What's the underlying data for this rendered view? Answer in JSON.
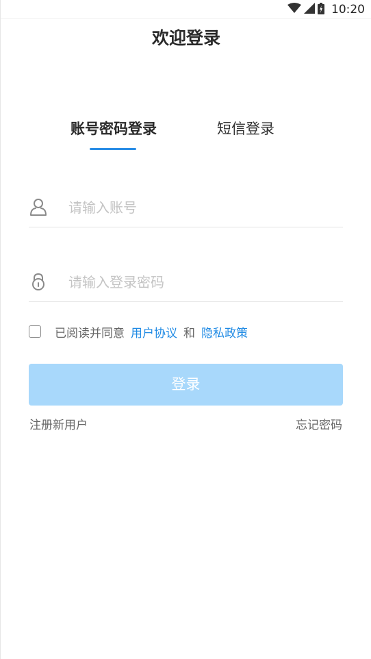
{
  "status_bar": {
    "time": "10:20",
    "icons": [
      "wifi-icon",
      "cell-signal-icon",
      "battery-icon"
    ]
  },
  "header": {
    "title": "欢迎登录"
  },
  "tabs": [
    {
      "label": "账号密码登录",
      "active": true
    },
    {
      "label": "短信登录",
      "active": false
    }
  ],
  "form": {
    "account_placeholder": "请输入账号",
    "account_value": "",
    "password_placeholder": "请输入登录密码",
    "password_value": "",
    "agreement": {
      "checked": false,
      "prefix": "已阅读并同意",
      "user_agreement": "用户协议",
      "and": "和",
      "privacy_policy": "隐私政策"
    },
    "login_label": "登录"
  },
  "links": {
    "register": "注册新用户",
    "forgot_password": "忘记密码"
  },
  "colors": {
    "accent": "#1f8ae4",
    "button_disabled": "#a8d8fb",
    "placeholder": "#c4c4c4"
  }
}
